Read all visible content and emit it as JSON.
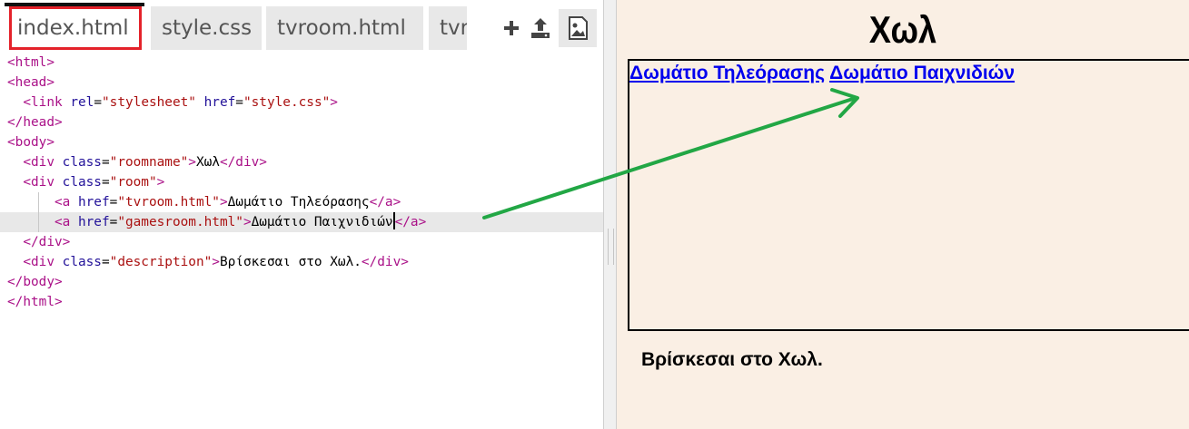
{
  "tabs": [
    {
      "label": "index.html",
      "active": true
    },
    {
      "label": "style.css",
      "active": false
    },
    {
      "label": "tvroom.html",
      "active": false
    },
    {
      "label": "tvr",
      "active": false
    }
  ],
  "toolbar": {
    "add_icon": "plus-icon",
    "upload_icon": "upload-icon",
    "preview_icon": "image-icon"
  },
  "code_lines": [
    {
      "t": "<html>"
    },
    {
      "t": "<head>"
    },
    {
      "t": "  <link rel=\"stylesheet\" href=\"style.css\">"
    },
    {
      "t": "</head>"
    },
    {
      "t": "<body>"
    },
    {
      "t": "  <div class=\"roomname\">Χωλ</div>"
    },
    {
      "t": "  <div class=\"room\">"
    },
    {
      "t": "      <a href=\"tvroom.html\">Δωμάτιο Τηλεόρασης</a>"
    },
    {
      "t": "      <a href=\"gamesroom.html\">Δωμάτιο Παιχνιδιών</a>"
    },
    {
      "t": "  </div>"
    },
    {
      "t": "  <div class=\"description\">Βρίσκεσαι στο Χωλ.</div>"
    },
    {
      "t": "</body>"
    },
    {
      "t": "</html>"
    }
  ],
  "highlighted_line": 9,
  "preview": {
    "roomname": "Χωλ",
    "links": [
      "Δωμάτιο Τηλεόρασης",
      "Δωμάτιο Παιχνιδιών"
    ],
    "description": "Βρίσκεσαι στο Χωλ."
  },
  "colors": {
    "tag": "#aa1188",
    "attr": "#221199",
    "string": "#aa1111",
    "link": "#0000ee",
    "preview_bg": "#faefe4",
    "annotation_arrow": "#22a745",
    "active_tab_border": "#e4222a"
  }
}
